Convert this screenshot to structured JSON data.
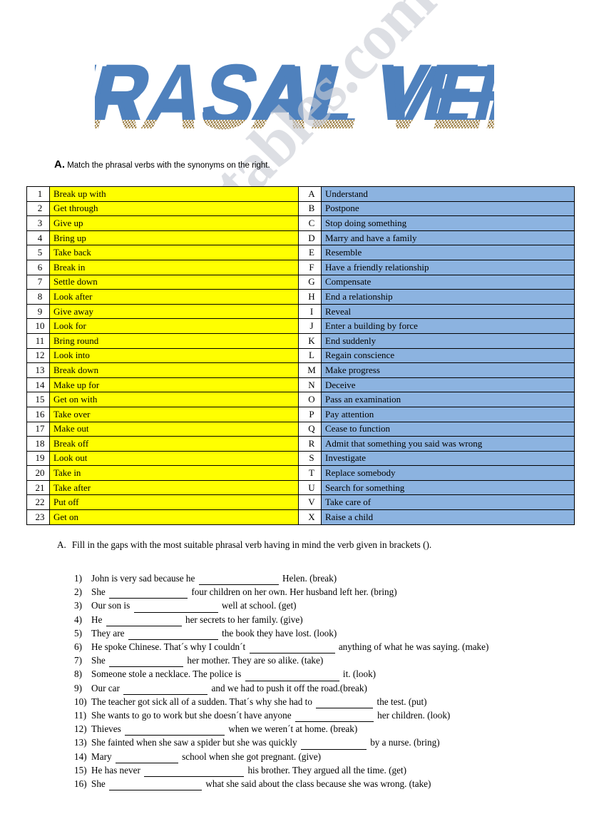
{
  "title": {
    "text": "PHRASAL VERBS",
    "fill_color": "#4f81bd",
    "shadow_color": "#8a6a2f"
  },
  "watermark": {
    "text": "ESLprintables.com",
    "color": "#c9ccd4"
  },
  "section_a": {
    "letter": "A.",
    "instruction": "Match the phrasal verbs with the synonyms on the right.",
    "verb_rows": [
      {
        "num": "1",
        "verb": "Break up with"
      },
      {
        "num": "2",
        "verb": "Get through"
      },
      {
        "num": "3",
        "verb": "Give up"
      },
      {
        "num": "4",
        "verb": "Bring up"
      },
      {
        "num": "5",
        "verb": "Take back"
      },
      {
        "num": "6",
        "verb": "Break in"
      },
      {
        "num": "7",
        "verb": "Settle down"
      },
      {
        "num": "8",
        "verb": "Look after"
      },
      {
        "num": "9",
        "verb": "Give away"
      },
      {
        "num": "10",
        "verb": "Look for"
      },
      {
        "num": "11",
        "verb": "Bring round"
      },
      {
        "num": "12",
        "verb": "Look into"
      },
      {
        "num": "13",
        "verb": "Break down"
      },
      {
        "num": "14",
        "verb": "Make up for"
      },
      {
        "num": "15",
        "verb": "Get on with"
      },
      {
        "num": "16",
        "verb": "Take over"
      },
      {
        "num": "17",
        "verb": "Make out"
      },
      {
        "num": "18",
        "verb": "Break off"
      },
      {
        "num": "19",
        "verb": "Look out"
      },
      {
        "num": "20",
        "verb": "Take in"
      },
      {
        "num": "21",
        "verb": "Take after"
      },
      {
        "num": "22",
        "verb": "Put off"
      },
      {
        "num": "23",
        "verb": "Get on"
      }
    ],
    "definition_rows": [
      {
        "letter": "A",
        "definition": "Understand"
      },
      {
        "letter": "B",
        "definition": "Postpone"
      },
      {
        "letter": "C",
        "definition": "Stop doing something"
      },
      {
        "letter": "D",
        "definition": "Marry and have a family"
      },
      {
        "letter": "E",
        "definition": "Resemble"
      },
      {
        "letter": "F",
        "definition": "Have a friendly relationship"
      },
      {
        "letter": "G",
        "definition": "Compensate"
      },
      {
        "letter": "H",
        "definition": "End a relationship"
      },
      {
        "letter": "I",
        "definition": "Reveal"
      },
      {
        "letter": "J",
        "definition": "Enter a building by force"
      },
      {
        "letter": "K",
        "definition": "End suddenly"
      },
      {
        "letter": "L",
        "definition": "Regain conscience"
      },
      {
        "letter": "M",
        "definition": "Make progress"
      },
      {
        "letter": "N",
        "definition": "Deceive"
      },
      {
        "letter": "O",
        "definition": "Pass an examination"
      },
      {
        "letter": "P",
        "definition": "Pay attention"
      },
      {
        "letter": "Q",
        "definition": "Cease to function"
      },
      {
        "letter": "R",
        "definition": "Admit that something you said was wrong"
      },
      {
        "letter": "S",
        "definition": "Investigate"
      },
      {
        "letter": "T",
        "definition": "Replace somebody"
      },
      {
        "letter": "U",
        "definition": "Search for something"
      },
      {
        "letter": "V",
        "definition": "Take care of"
      },
      {
        "letter": "X",
        "definition": "Raise a child"
      }
    ]
  },
  "section_b": {
    "letter": "A.",
    "instruction": "Fill in the gaps with the most suitable phrasal verb having in mind the verb given in brackets ().",
    "items": [
      {
        "num": "1)",
        "before": "John is very sad because he",
        "blank_width": 112,
        "after": "Helen. (break)"
      },
      {
        "num": "2)",
        "before": "She",
        "blank_width": 110,
        "after": "four children on her own. Her husband left her. (bring)"
      },
      {
        "num": "3)",
        "before": "Our son is",
        "blank_width": 118,
        "after": "well at school. (get)"
      },
      {
        "num": "4)",
        "before": "He",
        "blank_width": 106,
        "after": "her secrets to her family. (give)"
      },
      {
        "num": "5)",
        "before": "They are",
        "blank_width": 126,
        "after": "the book they have lost. (look)"
      },
      {
        "num": "6)",
        "before": "He spoke Chinese. That´s why I couldn´t",
        "blank_width": 120,
        "after": "anything of what he was saying. (make)"
      },
      {
        "num": "7)",
        "before": "She",
        "blank_width": 104,
        "after": "her mother. They are so alike. (take)"
      },
      {
        "num": "8)",
        "before": "Someone stole a necklace. The police is",
        "blank_width": 132,
        "after": "it. (look)"
      },
      {
        "num": "9)",
        "before": "Our car",
        "blank_width": 118,
        "after": "and we had to push it off the road.(break)"
      },
      {
        "num": "10)",
        "before": "The teacher got sick all of a sudden. That´s why she had to",
        "blank_width": 80,
        "after": "the test. (put)"
      },
      {
        "num": "11)",
        "before": "She wants to go to work but she doesn´t have anyone",
        "blank_width": 110,
        "after": "her children. (look)"
      },
      {
        "num": "12)",
        "before": "Thieves",
        "blank_width": 140,
        "after": "when we weren´t at home. (break)"
      },
      {
        "num": "13)",
        "before": "She fainted when she saw a spider but she was quickly",
        "blank_width": 92,
        "after": "by a nurse. (bring)"
      },
      {
        "num": "14)",
        "before": "Mary",
        "blank_width": 88,
        "after": "school when she got pregnant. (give)"
      },
      {
        "num": "15)",
        "before": "He has never",
        "blank_width": 140,
        "after": "his brother. They argued all the time. (get)"
      },
      {
        "num": "16)",
        "before": "She",
        "blank_width": 130,
        "after": "what she said about the class because she was wrong. (take)"
      }
    ]
  }
}
